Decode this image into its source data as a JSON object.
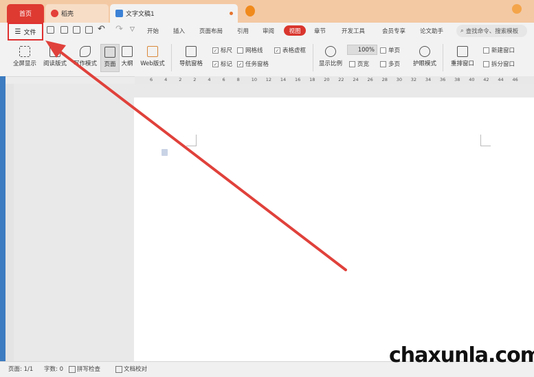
{
  "tabs": {
    "home": "首页",
    "docer": "稻壳",
    "document": "文字文稿1"
  },
  "file_button": "文件",
  "menu_tabs": [
    "开始",
    "插入",
    "页面布局",
    "引用",
    "审阅",
    "视图",
    "章节",
    "开发工具",
    "会员专享",
    "论文助手"
  ],
  "active_tab": "视图",
  "search": {
    "text": "查找命令、搜索模板"
  },
  "ribbon": {
    "fullscreen": "全屏显示",
    "reading": "阅读版式",
    "writing": "写作模式",
    "page": "页面",
    "outline": "大纲",
    "web": "Web版式",
    "nav_pane": "导航窗格",
    "ruler": "标尺",
    "gridlines": "网格线",
    "table_gridlines": "表格虚框",
    "marks": "标记",
    "task_pane": "任务窗格",
    "zoom": "显示比例",
    "zoom_value": "100%",
    "single_page": "单页",
    "page_width": "页宽",
    "multi_page": "多页",
    "eye_protect": "护眼模式",
    "rearrange": "重排窗口",
    "new_window": "新建窗口",
    "split_window": "拆分窗口"
  },
  "ruler_ticks": [
    "6",
    "4",
    "2",
    "2",
    "4",
    "6",
    "8",
    "10",
    "12",
    "14",
    "16",
    "18",
    "20",
    "22",
    "24",
    "26",
    "28",
    "30",
    "32",
    "34",
    "36",
    "38",
    "40",
    "42",
    "44",
    "46"
  ],
  "status": {
    "page": "页面: 1/1",
    "words": "字数: 0",
    "spell": "拼写检查",
    "proof": "文档校对"
  },
  "watermark": "chaxunla.com",
  "colors": {
    "accent_red": "#e03030",
    "arrow": "#e0413b",
    "title_bar": "#f3c9a4"
  }
}
